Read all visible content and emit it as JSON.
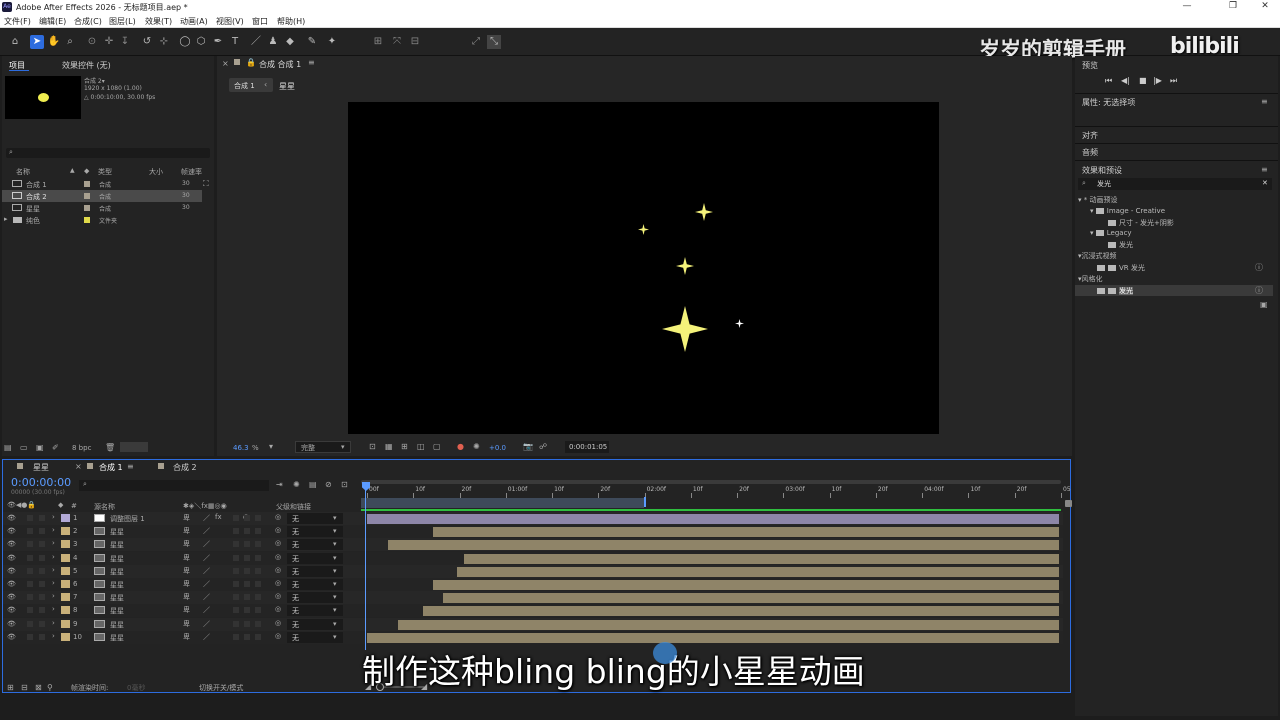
{
  "window": {
    "title": "Adobe After Effects 2026 - 无标题项目.aep *",
    "minimize": "—",
    "restore": "❐",
    "close": "✕"
  },
  "menu": [
    "文件(F)",
    "编辑(E)",
    "合成(C)",
    "图层(L)",
    "效果(T)",
    "动画(A)",
    "视图(V)",
    "窗口",
    "帮助(H)"
  ],
  "toolbar": {
    "align_label": "对齐"
  },
  "watermark": {
    "author": "岁岁的剪辑手册",
    "logo": "bilibili"
  },
  "project_panel": {
    "tab_project": "项目",
    "tab_effects": "效果控件 (无)",
    "comp_name": "合成 2▾",
    "comp_info_1": "1920 x 1080 (1.00)",
    "comp_info_2": "△ 0:00:10:00, 30.00 fps",
    "search_placeholder": "",
    "columns": {
      "name": "名称",
      "type": "类型",
      "size": "大小",
      "fps": "帧速率"
    },
    "items": [
      {
        "name": "合成 1",
        "type": "合成",
        "fps": "30"
      },
      {
        "name": "合成 2",
        "type": "合成",
        "fps": "30"
      },
      {
        "name": "星星",
        "type": "合成",
        "fps": "30"
      },
      {
        "name": "纯色",
        "type": "文件夹",
        "fps": ""
      }
    ],
    "bpc": "8 bpc"
  },
  "composition": {
    "tab": "合成 合成 1",
    "breadcrumb_comp": "合成 1",
    "breadcrumb_layer": "星星",
    "zoom": "46.3",
    "quality": "完整",
    "exposure": "+0.0",
    "timecode": "0:00:01:05"
  },
  "right_panel": {
    "preview_label": "预览",
    "properties": "属性: 无选择项",
    "align": "对齐",
    "audio": "音频",
    "effects_presets": "效果和预设",
    "search_value": "发光",
    "tree": [
      {
        "label": "* 动画预设",
        "indent": 0
      },
      {
        "label": "Image - Creative",
        "indent": 1
      },
      {
        "label": "尺寸 - 发光+阴影",
        "indent": 2
      },
      {
        "label": "Legacy",
        "indent": 1
      },
      {
        "label": "发光",
        "indent": 2
      },
      {
        "label": "沉浸式视频",
        "indent": 0
      },
      {
        "label": "VR 发光",
        "indent": 1
      },
      {
        "label": "风格化",
        "indent": 0
      },
      {
        "label": "发光",
        "indent": 1
      }
    ]
  },
  "timeline": {
    "tabs": [
      "星星",
      "合成 1",
      "合成 2"
    ],
    "timecode": "0:00:00:00",
    "fps_note": "00000 (30.00 fps)",
    "columns": {
      "source": "源名称",
      "parent": "父级和链接"
    },
    "ruler": [
      "00f",
      "10f",
      "20f",
      "01:00f",
      "10f",
      "20f",
      "02:00f",
      "10f",
      "20f",
      "03:00f",
      "10f",
      "20f",
      "04:00f",
      "10f",
      "20f",
      "05"
    ],
    "layers": [
      {
        "num": "1",
        "name": "调整图层 1",
        "parent": "无",
        "start": 0.0
      },
      {
        "num": "2",
        "name": "星星",
        "parent": "无",
        "start": 0.095
      },
      {
        "num": "3",
        "name": "星星",
        "parent": "无",
        "start": 0.03
      },
      {
        "num": "4",
        "name": "星星",
        "parent": "无",
        "start": 0.14
      },
      {
        "num": "5",
        "name": "星星",
        "parent": "无",
        "start": 0.13
      },
      {
        "num": "6",
        "name": "星星",
        "parent": "无",
        "start": 0.095
      },
      {
        "num": "7",
        "name": "星星",
        "parent": "无",
        "start": 0.11
      },
      {
        "num": "8",
        "name": "星星",
        "parent": "无",
        "start": 0.08
      },
      {
        "num": "9",
        "name": "星星",
        "parent": "无",
        "start": 0.045
      },
      {
        "num": "10",
        "name": "星星",
        "parent": "无",
        "start": 0.0
      }
    ],
    "footer_render": "帧渲染时间:",
    "footer_render_val": "0毫秒",
    "footer_toggle": "切换开关/模式"
  },
  "subtitle": "制作这种bling bling的小星星动画",
  "colors": {
    "accent": "#2d6cdf",
    "star": "#f4f27a",
    "layer_bar": "#8f8468",
    "adjustment_bar": "#8d86a8",
    "timecode": "#5b9bff"
  }
}
